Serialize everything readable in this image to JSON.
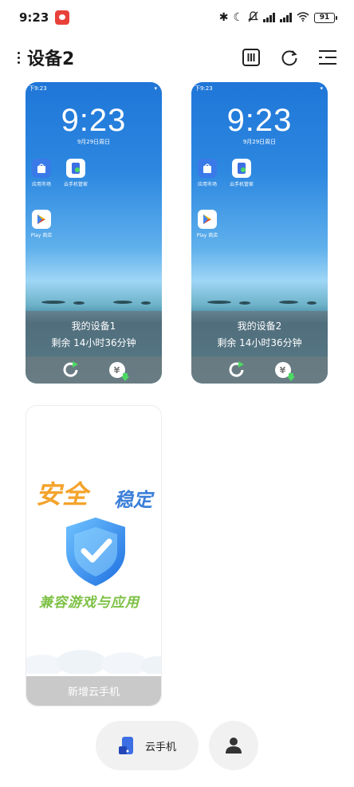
{
  "status_bar": {
    "time": "9:23",
    "battery": "91"
  },
  "header": {
    "title": "设备2"
  },
  "devices": [
    {
      "phone_time": "9:23",
      "phone_status_time": "下9:23",
      "phone_date": "9月29日周日",
      "apps": [
        {
          "label": "应用市场"
        },
        {
          "label": "云手机管家"
        },
        {
          "label": "Play 商店"
        }
      ],
      "name": "我的设备1",
      "remaining": "剩余 14小时36分钟"
    },
    {
      "phone_time": "9:23",
      "phone_status_time": "下9:23",
      "phone_date": "9月29日周日",
      "apps": [
        {
          "label": "应用市场"
        },
        {
          "label": "云手机管家"
        },
        {
          "label": "Play 商店"
        }
      ],
      "name": "我的设备2",
      "remaining": "剩余 14小时36分钟"
    }
  ],
  "add_card": {
    "promo_line1": "安全",
    "promo_line2": "稳定",
    "promo_line3": "兼容游戏与应用",
    "button_label": "新增云手机"
  },
  "bottom_nav": {
    "cloud_phone_label": "云手机"
  },
  "colors": {
    "accent_blue": "#3b6fe3",
    "refresh_green": "#4cd964",
    "add_button_bg": "#c9c9c9"
  }
}
